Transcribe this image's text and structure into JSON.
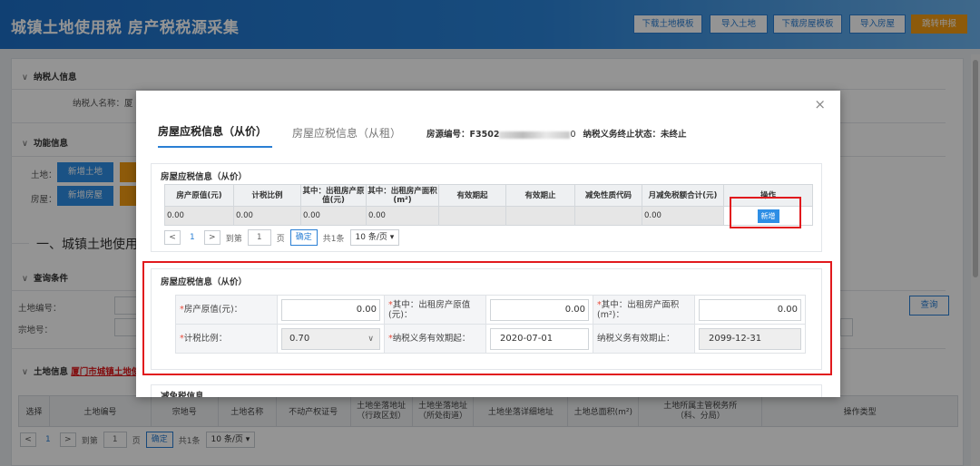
{
  "header": {
    "title": "城镇土地使用税 房产税税源采集",
    "buttons": [
      {
        "label": "下载土地模板",
        "style": "outline"
      },
      {
        "label": "导入土地",
        "style": "outline"
      },
      {
        "label": "下载房屋模板",
        "style": "outline"
      },
      {
        "label": "导入房屋",
        "style": "outline"
      },
      {
        "label": "跳转申报",
        "style": "orange"
      }
    ]
  },
  "background": {
    "taxpayer_section": "纳税人信息",
    "taxpayer_label": "纳税人名称：厦",
    "function_section": "功能信息",
    "land_label": "土地：",
    "land_add": "新增土地",
    "house_label": "房屋：",
    "house_add": "新增房屋",
    "big_title": "一、城镇土地使用税",
    "query_section": "查询条件",
    "land_no_label": "土地编号：",
    "parcel_label": "宗地号：",
    "query_button": "查询",
    "land_info_section": "土地信息",
    "land_info_link": "厦门市城镇土地使",
    "table_headers": [
      "选择",
      "土地编号",
      "宗地号",
      "土地名称",
      "不动产权证号",
      "土地坐落地址\n（行政区划）",
      "土地坐落地址\n（所处街道）",
      "土地坐落详细地址",
      "土地总面积(m²)",
      "土地所属主管税务所\n（科、分局）",
      "操作类型"
    ],
    "pager": {
      "prev": "<",
      "page": "1",
      "next": ">",
      "goto": "到第",
      "page_value": "1",
      "page_unit": "页",
      "ok": "确定",
      "total": "共1条",
      "per_page": "10 条/页 ▾"
    }
  },
  "modal": {
    "close": "×",
    "tabs": [
      {
        "label": "房屋应税信息（从价）",
        "active": true
      },
      {
        "label": "房屋应税信息（从租）",
        "active": false
      }
    ],
    "house_no_label": "房源编号：F3502",
    "house_no_suffix": "0",
    "end_status": "纳税义务终止状态：未终止",
    "panel1": {
      "title": "房屋应税信息（从价）",
      "headers": [
        "房产原值(元)",
        "计税比例",
        "其中：出租房产原值(元)",
        "其中：出租房产面积(m²)",
        "有效期起",
        "有效期止",
        "减免性质代码",
        "月减免税额合计(元)",
        "操作"
      ],
      "row": [
        "0.00",
        "0.00",
        "0.00",
        "0.00",
        "",
        "",
        "",
        "0.00",
        ""
      ],
      "add_button": "新增",
      "pager": {
        "prev": "<",
        "page": "1",
        "next": ">",
        "goto": "到第",
        "page_value": "1",
        "page_unit": "页",
        "ok": "确定",
        "total": "共1条",
        "per_page": "10 条/页 ▾"
      }
    },
    "panel2": {
      "title": "房屋应税信息（从价）",
      "original_value_label": "房产原值(元)：",
      "original_value": "0.00",
      "rent_value_label": "其中：出租房产原值(元)：",
      "rent_value": "0.00",
      "rent_area_label": "其中：出租房产面积(m²)：",
      "rent_area": "0.00",
      "ratio_label": "计税比例：",
      "ratio": "0.70",
      "start_label": "纳税义务有效期起：",
      "start": "2020-07-01",
      "end_label": "纳税义务有效期止：",
      "end": "2099-12-31"
    },
    "panel3_title": "减免税信息"
  }
}
